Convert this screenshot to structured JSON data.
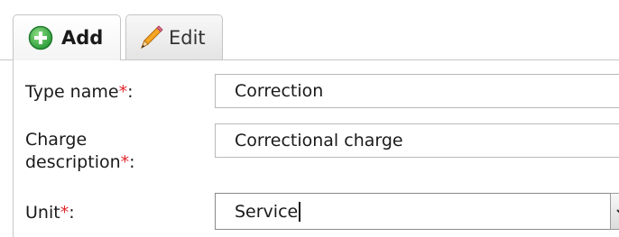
{
  "tabs": {
    "add_label": "Add",
    "edit_label": "Edit"
  },
  "form": {
    "type_name": {
      "label": "Type name",
      "required_mark": "*",
      "suffix": ":",
      "value": "Correction"
    },
    "charge_description": {
      "label_line1": "Charge",
      "label_line2": "description",
      "required_mark": "*",
      "suffix": ":",
      "value": "Correctional charge"
    },
    "unit": {
      "label": "Unit",
      "required_mark": "*",
      "suffix": ":",
      "value": "Service"
    }
  },
  "icons": {
    "add": "plus-circle-icon",
    "edit": "pencil-icon",
    "dropdown": "chevron-down-icon"
  },
  "colors": {
    "required": "#e0282c",
    "add_icon": "#2e9e3c"
  }
}
